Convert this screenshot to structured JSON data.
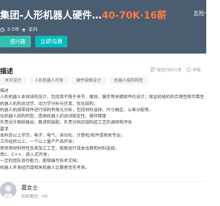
{
  "header": {
    "title": "集团-人形机器人硬件…",
    "salary": "40-70K·16薪",
    "right_text": "五险一",
    "experience": "3-5年",
    "education": "本科",
    "interest_button": "感兴趣",
    "chat_button": "立即沟通"
  },
  "section": {
    "title": "描述",
    "favorite": "微信扫码分享",
    "report": "举报"
  },
  "tags": [
    "关节设计",
    "人形机器人开发",
    "硬件规格设计",
    "机器人结构构型"
  ],
  "description": [
    "描述",
    "人形机器人本体结构设计，包括但不限于关节、躯体、腿手等关键部件的设计；保证机械机构合理性和可靠性",
    "机器人机构运动学、动力学分析与仿真，优化结构；",
    "机器人机械零部件进行结构有限元分析，包括材料选择、尺寸确定、公差分配等。",
    "化机器人结构构型，提高机器人的运动稳定性、操作精度",
    "负责设计图纸输出，跟进和装配，负责对供应链制造工艺的调研和评估",
    "要求",
    "本科及以上学历，电子、电气、自动化、计算机/软件或相关专业；",
    "工作经验以上，一个以上量产产品开发；",
    "悉常用材料特性及其加工工艺，能够运行成本估算和材料选择。",
    "悉C、C++、嵌入式开发；",
    "一定的团队协作能力，能够编写技术文档；",
    "机器人开发经历或相关机器人比赛者优先考虑。"
  ],
  "recruiter": {
    "name": "葛女士",
    "subtitle": "蚂蚁集团 · HR"
  },
  "colors": {
    "header_bg": "#4b5d70",
    "salary": "#ff7a45",
    "accent": "#00bebd"
  }
}
